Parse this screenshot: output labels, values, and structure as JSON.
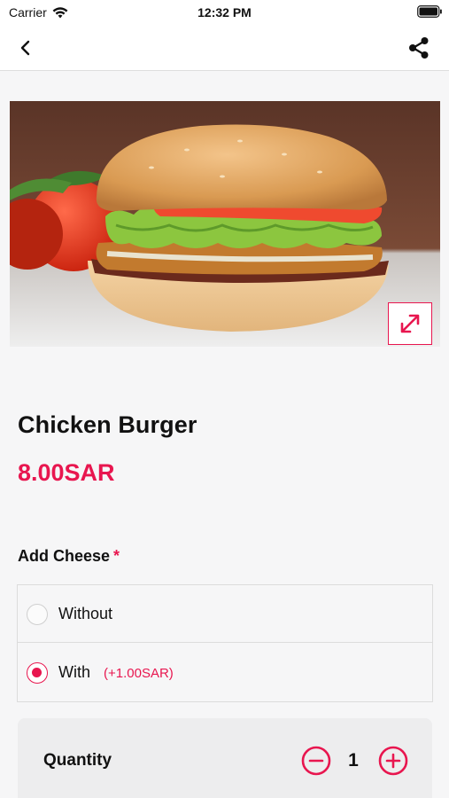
{
  "status_bar": {
    "carrier": "Carrier",
    "time": "12:32 PM",
    "icons": [
      "wifi-icon",
      "battery-icon"
    ]
  },
  "nav": {
    "back_icon": "chevron-left-icon",
    "share_icon": "share-icon"
  },
  "product": {
    "image": "chicken-burger-photo",
    "expand_icon": "expand-arrows-icon",
    "name": "Chicken Burger",
    "price": "8.00SAR"
  },
  "option_group": {
    "title": "Add Cheese",
    "required_marker": "*",
    "options": [
      {
        "label": "Without",
        "extra": "",
        "selected": false
      },
      {
        "label": "With",
        "extra": "(+1.00SAR)",
        "selected": true
      }
    ]
  },
  "quantity": {
    "label": "Quantity",
    "value": "1",
    "minus_icon": "minus-circle-icon",
    "plus_icon": "plus-circle-icon"
  },
  "colors": {
    "accent": "#e8164f",
    "background": "#f6f6f7",
    "card": "#ededee"
  }
}
